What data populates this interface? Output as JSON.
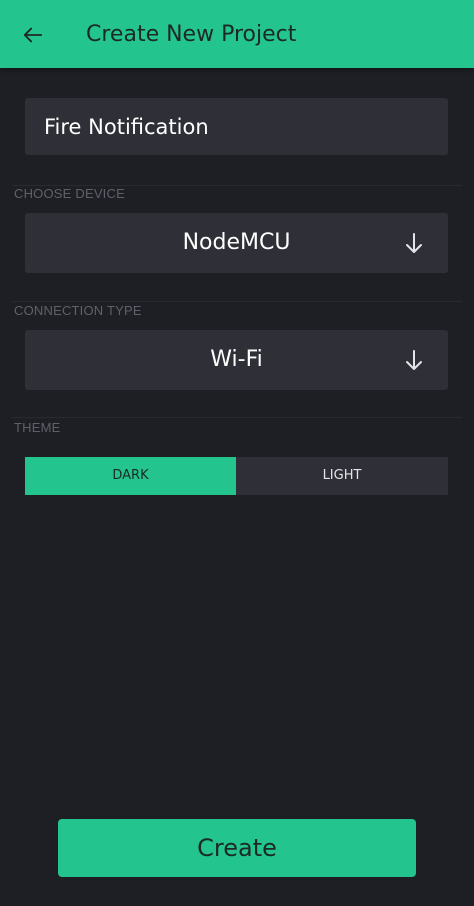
{
  "header": {
    "title": "Create New Project",
    "background": "#24c48e",
    "back_icon": "arrow-left-icon"
  },
  "project_name": {
    "value": "Fire Notification"
  },
  "device": {
    "label": "CHOOSE DEVICE",
    "selected": "NodeMCU",
    "icon": "arrow-down-icon"
  },
  "connection": {
    "label": "CONNECTION TYPE",
    "selected": "Wi-Fi",
    "icon": "arrow-down-icon"
  },
  "theme": {
    "label": "THEME",
    "options": [
      "DARK",
      "LIGHT"
    ],
    "selected": "DARK",
    "accent": "#24c48e"
  },
  "actions": {
    "create_label": "Create"
  }
}
